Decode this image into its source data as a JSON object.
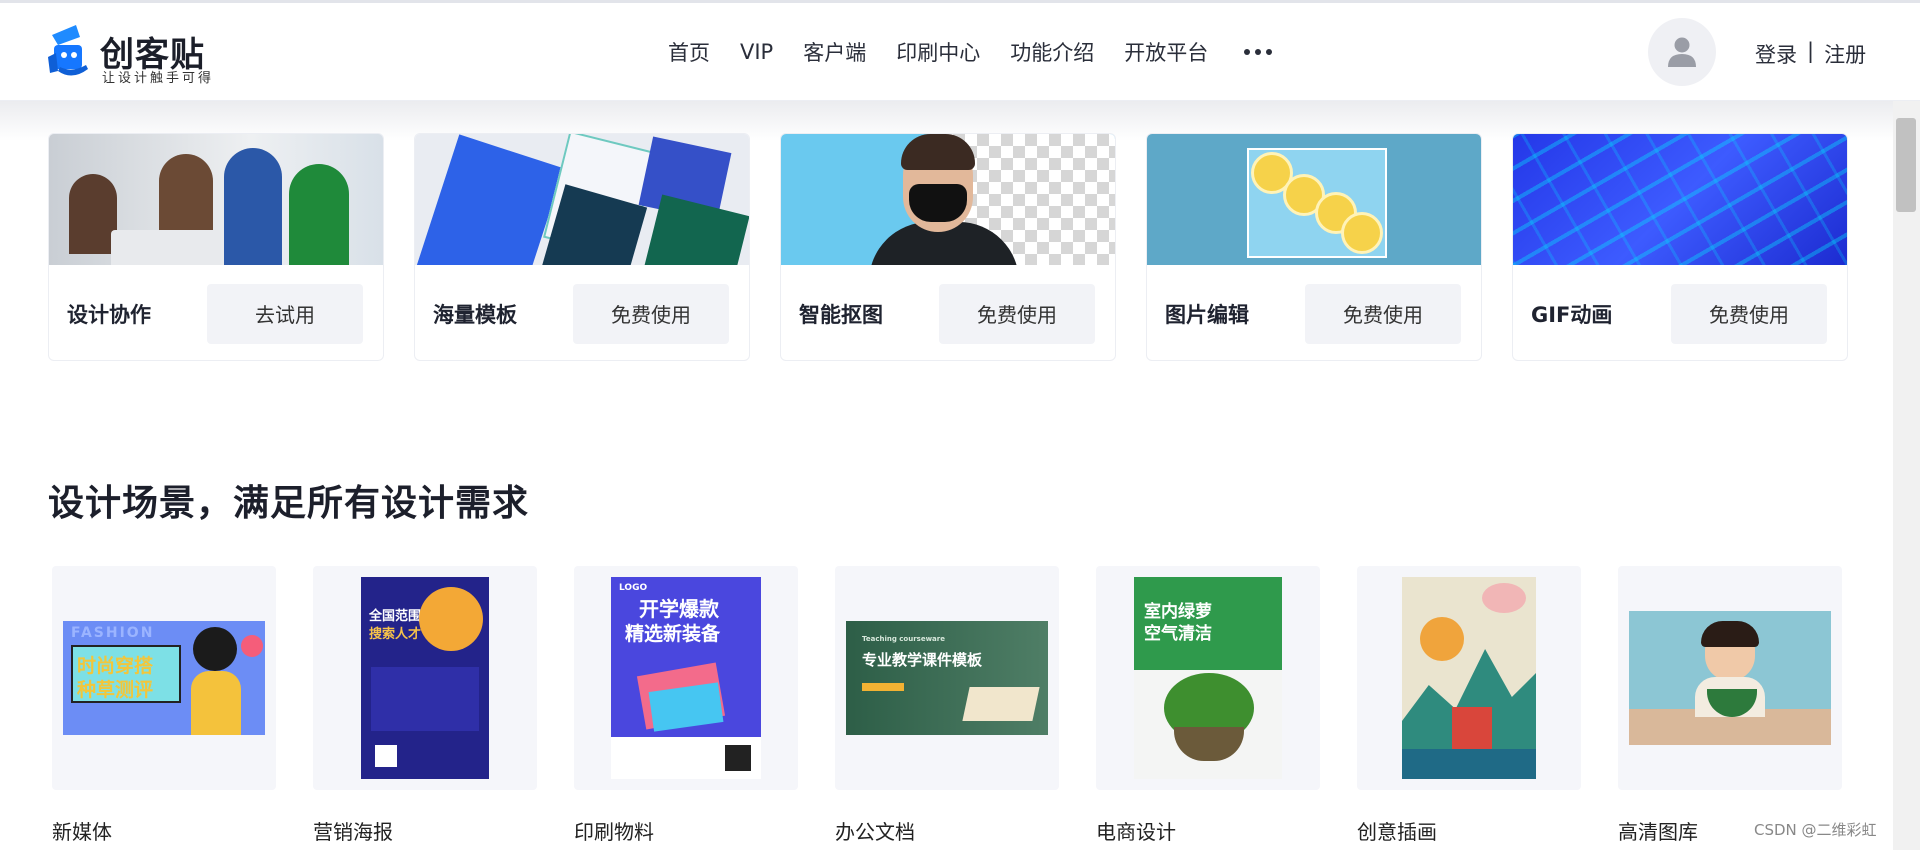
{
  "brand": {
    "name": "创客贴",
    "slogan": "让设计触手可得"
  },
  "nav": {
    "items": [
      "首页",
      "VIP",
      "客户端",
      "印刷中心",
      "功能介绍",
      "开放平台"
    ]
  },
  "auth": {
    "login": "登录",
    "separator": "|",
    "register": "注册"
  },
  "features": [
    {
      "title": "设计协作",
      "button": "去试用"
    },
    {
      "title": "海量模板",
      "button": "免费使用"
    },
    {
      "title": "智能抠图",
      "button": "免费使用"
    },
    {
      "title": "图片编辑",
      "button": "免费使用"
    },
    {
      "title": "GIF动画",
      "button": "免费使用"
    }
  ],
  "section": {
    "title": "设计场景，满足所有设计需求"
  },
  "scenes": [
    {
      "label": "新媒体",
      "thumb_text": [
        "FASHION",
        "时尚穿搭",
        "种草测评"
      ]
    },
    {
      "label": "营销海报",
      "thumb_text": [
        "全国范围",
        "搜索人才"
      ]
    },
    {
      "label": "印刷物料",
      "thumb_text": [
        "LOGO",
        "开学爆款",
        "精选新装备"
      ]
    },
    {
      "label": "办公文档",
      "thumb_text": [
        "Teaching courseware",
        "专业教学课件模板"
      ]
    },
    {
      "label": "电商设计",
      "thumb_text": [
        "室内绿萝",
        "空气清洁"
      ]
    },
    {
      "label": "创意插画",
      "thumb_text": []
    },
    {
      "label": "高清图库",
      "thumb_text": []
    }
  ],
  "watermark": "CSDN @二维彩虹",
  "colors": {
    "brand_blue": "#1677ff",
    "button_bg": "#f2f3f7",
    "thumb_bg": "#f5f6fa"
  }
}
